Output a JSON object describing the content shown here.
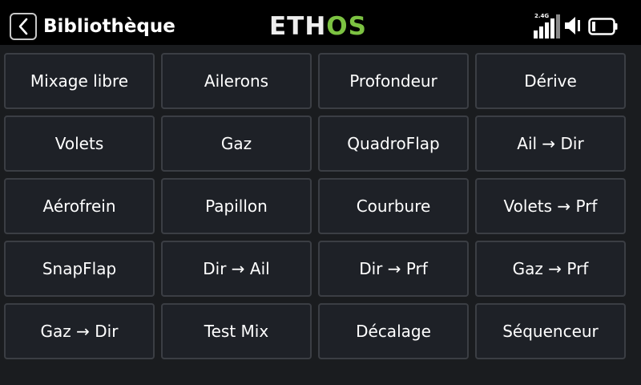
{
  "header": {
    "title": "Bibliothèque",
    "logo_part1": "ETH",
    "logo_part2": "OS",
    "band_label": "2.4G"
  },
  "icons": {
    "back": "chevron-left-icon",
    "signal": "signal-bars-icon",
    "speaker": "speaker-icon",
    "battery": "battery-icon"
  },
  "colors": {
    "accent_green": "#7cc242",
    "tile_background": "#1e2127",
    "tile_border": "#3b3e44"
  },
  "mixes": [
    "Mixage libre",
    "Ailerons",
    "Profondeur",
    "Dérive",
    "Volets",
    "Gaz",
    "QuadroFlap",
    "Ail → Dir",
    "Aérofrein",
    "Papillon",
    "Courbure",
    "Volets → Prf",
    "SnapFlap",
    "Dir → Ail",
    "Dir → Prf",
    "Gaz → Prf",
    "Gaz → Dir",
    "Test Mix",
    "Décalage",
    "Séquenceur"
  ]
}
